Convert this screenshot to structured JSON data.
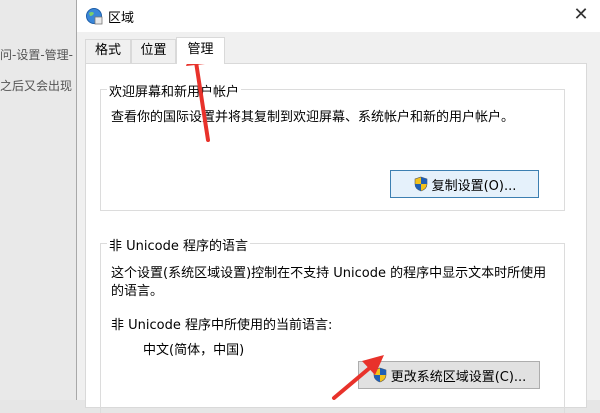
{
  "background": {
    "lines": [
      "问-设置-管理-",
      "之后又会出现"
    ]
  },
  "dialog": {
    "title": "区域",
    "close_glyph": "✕",
    "tabs": [
      {
        "label": "格式",
        "active": false
      },
      {
        "label": "位置",
        "active": false
      },
      {
        "label": "管理",
        "active": true
      }
    ],
    "welcome_group": {
      "title": "欢迎屏幕和新用户帐户",
      "description": "查看你的国际设置并将其复制到欢迎屏幕、系统帐户和新的用户帐户。",
      "button_label": "复制设置(O)..."
    },
    "unicode_group": {
      "title": "非 Unicode 程序的语言",
      "description_line1": "这个设置(系统区域设置)控制在不支持 Unicode 的程序中显示文本时所使用",
      "description_line2": "的语言。",
      "current_label": "非 Unicode 程序中所使用的当前语言:",
      "current_value": "中文(简体，中国)",
      "button_label": "更改系统区域设置(C)..."
    }
  },
  "colors": {
    "annotation_arrow": "#e8322b",
    "shield_blue": "#1f5fb5",
    "shield_yellow": "#f2c21b"
  }
}
